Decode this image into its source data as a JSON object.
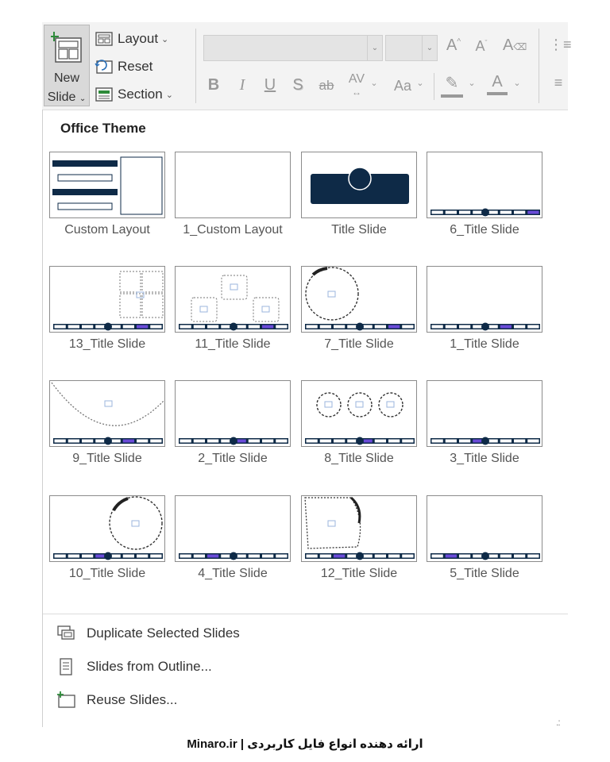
{
  "ribbon": {
    "new_slide_line1": "New",
    "new_slide_line2": "Slide",
    "layout_label": "Layout",
    "reset_label": "Reset",
    "section_label": "Section",
    "font_name_value": "",
    "font_size_value": "",
    "grow_font_glyph": "A^",
    "shrink_font_glyph": "Aˇ",
    "bold_glyph": "B",
    "italic_glyph": "I",
    "underline_glyph": "U",
    "shadow_glyph": "S",
    "strike_glyph": "ab",
    "spacing_glyph": "AV",
    "case_glyph": "Aa"
  },
  "gallery": {
    "heading": "Office Theme",
    "layouts": [
      "Custom Layout",
      "1_Custom Layout",
      "Title Slide",
      "6_Title Slide",
      "13_Title Slide",
      "11_Title Slide",
      "7_Title Slide",
      "1_Title Slide",
      "9_Title Slide",
      "2_Title Slide",
      "8_Title Slide",
      "3_Title Slide",
      "10_Title Slide",
      "4_Title Slide",
      "12_Title Slide",
      "5_Title Slide"
    ]
  },
  "menu": {
    "duplicate": "Duplicate Selected Slides",
    "outline": "Slides from Outline...",
    "reuse": "Reuse Slides..."
  },
  "footer": "Minaro.ir | ارائه دهنده انواع فایل کاربردی",
  "colors": {
    "navy": "#0e2a47",
    "accent": "#6a4bd8",
    "ribbon_bg": "#f3f3f3",
    "selected_btn": "#d9d9d9"
  }
}
